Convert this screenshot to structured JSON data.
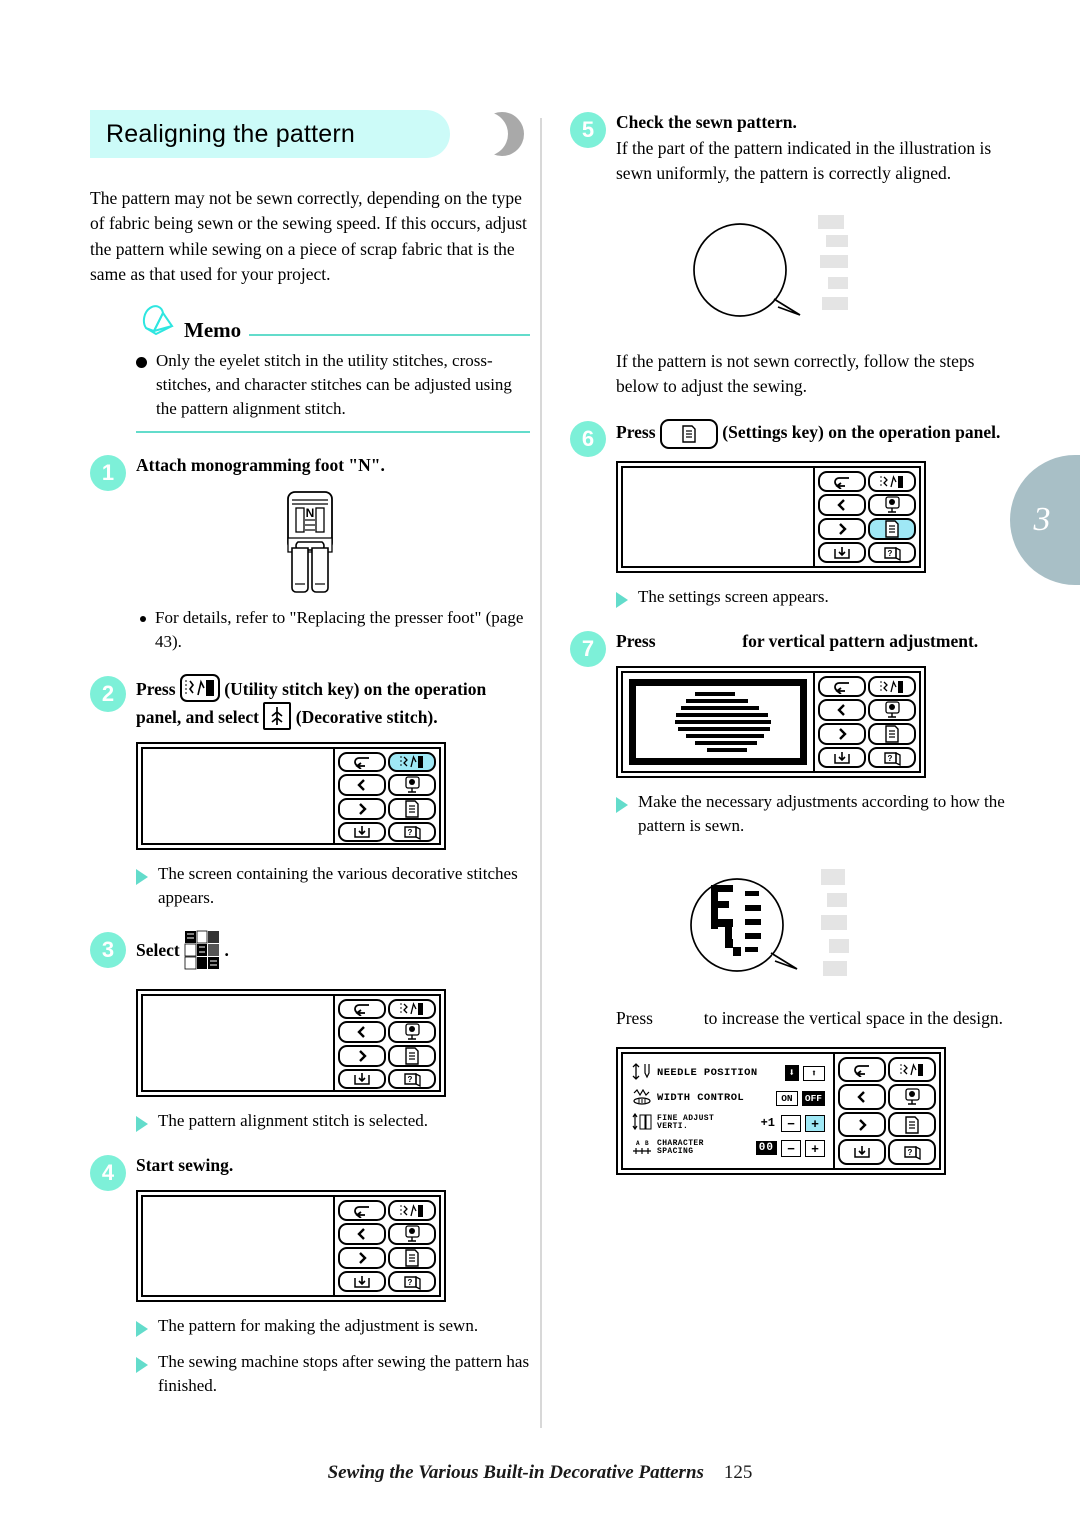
{
  "heading": {
    "title": "Realigning the pattern"
  },
  "chapter_tab": {
    "number": "3"
  },
  "intro": {
    "paragraph": "The pattern may not be sewn correctly, depending on the type of fabric being sewn or the sewing speed. If this occurs, adjust the pattern while sewing on a piece of scrap fabric that is the same as that used for your project."
  },
  "memo": {
    "title": "Memo",
    "icon": "memo-bell-icon",
    "items": [
      "Only the eyelet stitch in the utility stitches, cross-stitches, and character stitches can be adjusted using the pattern alignment stitch."
    ]
  },
  "steps": [
    {
      "number": "1",
      "title": "Attach monogramming foot \"N\".",
      "foot_label": "N",
      "note": "For details, refer to \"Replacing the presser foot\" (page 43)."
    },
    {
      "number": "2",
      "title_part1": "Press",
      "title_part2": "(Utility stitch key) on the operation panel, and select",
      "title_part3": "(Decorative stitch).",
      "result": "The screen containing the various decorative stitches appears."
    },
    {
      "number": "3",
      "title_part1": "Select",
      "title_part2": ".",
      "result": "The pattern alignment stitch is selected."
    },
    {
      "number": "4",
      "title": "Start sewing.",
      "result1": "The pattern for making the adjustment is sewn.",
      "result2": "The sewing machine stops after sewing the pattern has finished."
    },
    {
      "number": "5",
      "title": "Check the sewn pattern.",
      "body": "If the part of the pattern indicated in the illustration is sewn uniformly, the pattern is correctly aligned.",
      "after": "If the pattern is not sewn correctly, follow the steps below to adjust the sewing."
    },
    {
      "number": "6",
      "title_part1": "Press",
      "title_part2": "(Settings key) on the operation panel.",
      "result": "The settings screen appears."
    },
    {
      "number": "7",
      "title_part1": "Press",
      "title_part2": "for vertical pattern adjustment.",
      "result": "Make the necessary adjustments according to how the pattern is sewn.",
      "after_part1": "Press",
      "after_part2": "to increase the vertical space in the design."
    }
  ],
  "lcd_keys": [
    {
      "name": "back-key",
      "glyph": "↲"
    },
    {
      "name": "utility-stitch-key",
      "glyph": "utility"
    },
    {
      "name": "previous-key",
      "glyph": "‹"
    },
    {
      "name": "presser-foot-key",
      "glyph": "foot"
    },
    {
      "name": "next-key",
      "glyph": "›"
    },
    {
      "name": "settings-key",
      "glyph": "settings"
    },
    {
      "name": "memory-save-key",
      "glyph": "save"
    },
    {
      "name": "help-key",
      "glyph": "help"
    }
  ],
  "settings_screen": {
    "rows": [
      {
        "icon": "needle-position-icon",
        "label": "NEEDLE POSITION",
        "control": "toggle",
        "options": [
          "down",
          "up"
        ],
        "selected": "down"
      },
      {
        "icon": "width-control-icon",
        "label": "WIDTH CONTROL",
        "control": "onoff",
        "options": [
          "ON",
          "OFF"
        ],
        "selected": "OFF"
      },
      {
        "icon": "fine-adjust-icon",
        "label": "FINE ADJUST VERTI.",
        "label_line1": "FINE ADJUST",
        "label_line2": "VERTI.",
        "value": "+1",
        "minus": "−",
        "plus": "+",
        "highlighted": "plus"
      },
      {
        "icon": "character-spacing-icon",
        "label": "CHARACTER SPACING",
        "label_line1": "CHARACTER",
        "label_line2": "SPACING",
        "value": "00",
        "minus": "−",
        "plus": "+",
        "highlighted": "none"
      }
    ]
  },
  "footer": {
    "title": "Sewing the Various Built-in Decorative Patterns",
    "page": "125"
  },
  "colors": {
    "heading_bg": "#ccfbf8",
    "accent": "#63dccb",
    "step_circle": "#7df0d8",
    "key_highlight": "#9fe8f5",
    "chapter_tab": "#a8bfc6"
  }
}
